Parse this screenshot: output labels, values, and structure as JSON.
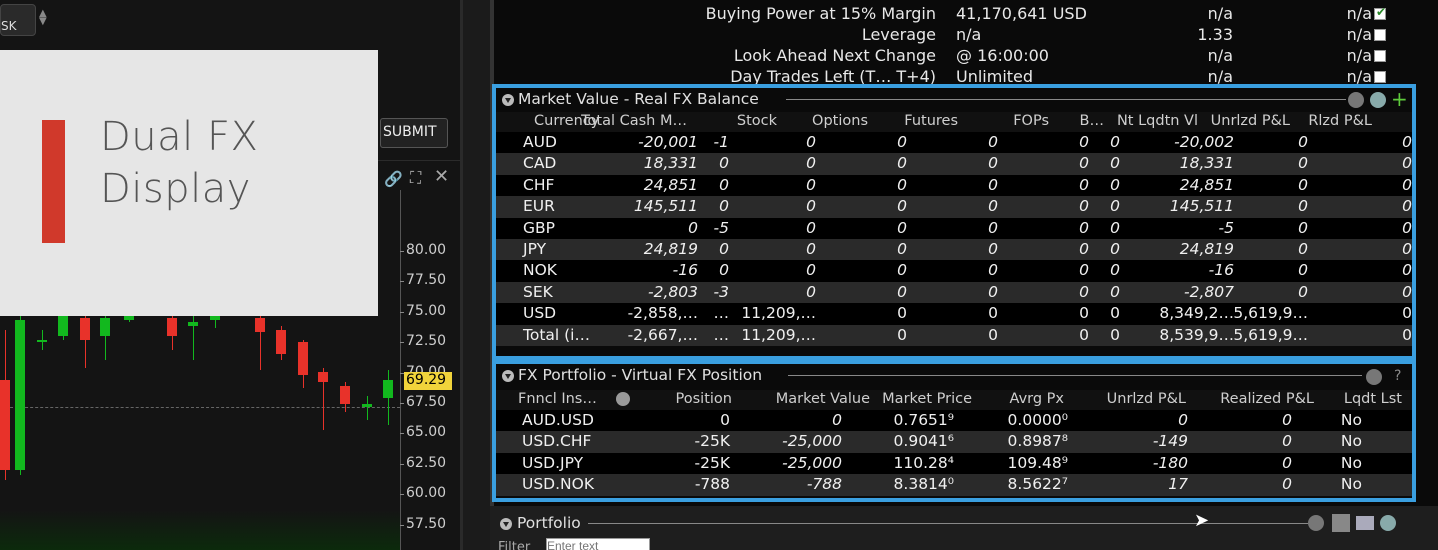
{
  "chart": {
    "order_box_text": "SK",
    "submit_label": "SUBMIT",
    "y_labels": [
      "80.00",
      "77.50",
      "75.00",
      "72.50",
      "70.00",
      "67.50",
      "65.00",
      "62.50",
      "60.00",
      "57.50"
    ],
    "last_price": "69.29",
    "colors": {
      "up": "#12b81e",
      "down": "#e8322a",
      "price_tag": "#f1d43b"
    }
  },
  "overlay": {
    "line1": "Dual FX",
    "line2": "Display"
  },
  "summary": [
    {
      "label": "Buying Power at 15% Margin",
      "v1": "41,170,641 USD",
      "v2": "n/a",
      "v3": "n/a",
      "checked": true
    },
    {
      "label": "Leverage",
      "v1": "n/a",
      "v2": "1.33",
      "v3": "n/a",
      "checked": false
    },
    {
      "label": "Look Ahead Next Change",
      "v1": "@ 16:00:00",
      "v2": "n/a",
      "v3": "n/a",
      "checked": false
    },
    {
      "label": "Day Trades Left (T… T+4)",
      "v1": "Unlimited",
      "v2": "n/a",
      "v3": "n/a",
      "checked": false
    }
  ],
  "market_value": {
    "title": "Market Value - Real FX Balance",
    "headers": [
      "Currency",
      "Total Cash M…",
      "Stock",
      "Options",
      "Futures",
      "FOPs",
      "B…",
      "Nt Lqdtn Vl",
      "Unrlzd P&L",
      "Rlzd P&L"
    ],
    "rows": [
      [
        "AUD",
        "-20,001",
        "-1",
        "0",
        "0",
        "0",
        "0",
        "0",
        "-20,002",
        "0",
        "0"
      ],
      [
        "CAD",
        "18,331",
        "0",
        "0",
        "0",
        "0",
        "0",
        "0",
        "18,331",
        "0",
        "0"
      ],
      [
        "CHF",
        "24,851",
        "0",
        "0",
        "0",
        "0",
        "0",
        "0",
        "24,851",
        "0",
        "0"
      ],
      [
        "EUR",
        "145,511",
        "0",
        "0",
        "0",
        "0",
        "0",
        "0",
        "145,511",
        "0",
        "0"
      ],
      [
        "GBP",
        "0",
        "-5",
        "0",
        "0",
        "0",
        "0",
        "0",
        "-5",
        "0",
        "0"
      ],
      [
        "JPY",
        "24,819",
        "0",
        "0",
        "0",
        "0",
        "0",
        "0",
        "24,819",
        "0",
        "0"
      ],
      [
        "NOK",
        "-16",
        "0",
        "0",
        "0",
        "0",
        "0",
        "0",
        "-16",
        "0",
        "0"
      ],
      [
        "SEK",
        "-2,803",
        "-3",
        "0",
        "0",
        "0",
        "0",
        "0",
        "-2,807",
        "0",
        "0"
      ],
      [
        "USD",
        "-2,858,…",
        "…",
        "11,209,…",
        "0",
        "0",
        "0",
        "0",
        "8,349,2…",
        "5,619,9…",
        "0"
      ],
      [
        "Total (i…",
        "-2,667,…",
        "…",
        "11,209,…",
        "0",
        "0",
        "0",
        "0",
        "8,539,9…",
        "5,619,9…",
        "0"
      ]
    ]
  },
  "fx_portfolio": {
    "title": "FX Portfolio - Virtual FX Position",
    "headers": [
      "Fnncl Ins…",
      "Position",
      "Market Value",
      "Market Price",
      "Avrg Px",
      "Unrlzd P&L",
      "Realized P&L",
      "Lqdt Lst"
    ],
    "rows": [
      [
        "AUD.USD",
        "0",
        "0",
        "0.7651⁹",
        "0.0000⁰",
        "0",
        "0",
        "No"
      ],
      [
        "USD.CHF",
        "-25K",
        "-25,000",
        "0.9041⁶",
        "0.8987⁸",
        "-149",
        "0",
        "No"
      ],
      [
        "USD.JPY",
        "-25K",
        "-25,000",
        "110.28⁴",
        "109.48⁹",
        "-180",
        "0",
        "No"
      ],
      [
        "USD.NOK",
        "-788",
        "-788",
        "8.3814⁰",
        "8.5622⁷",
        "17",
        "0",
        "No"
      ]
    ]
  },
  "portfolio": {
    "title": "Portfolio",
    "filter_label": "Filter",
    "filter_placeholder": "Enter text"
  }
}
